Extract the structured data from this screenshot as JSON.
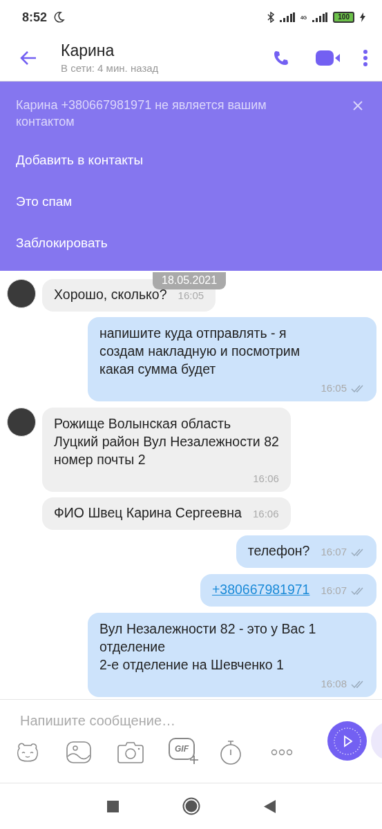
{
  "status_bar": {
    "time": "8:52",
    "battery": "100",
    "network": "4G"
  },
  "header": {
    "title": "Карина",
    "subtitle": "В сети: 4 мин. назад"
  },
  "banner": {
    "message": "Карина +380667981971 не является вашим контактом",
    "actions": [
      "Добавить в контакты",
      "Это спам",
      "Заблокировать"
    ]
  },
  "date_label": "18.05.2021",
  "messages": [
    {
      "outgoing": false,
      "kind": "text",
      "avatar": true,
      "text": "Хорошо, сколько?",
      "time": "16:05"
    },
    {
      "outgoing": true,
      "kind": "text",
      "text": "напишите куда отправлять - я\nсоздам накладную и посмотрим\nкакая сумма будет",
      "time": "16:05",
      "read": true
    },
    {
      "outgoing": false,
      "kind": "text",
      "avatar": true,
      "text": "Рожище Волынская область\nЛуцкий район Вул Незалежности 82\nномер почты 2",
      "time": "16:06"
    },
    {
      "outgoing": false,
      "kind": "text",
      "avatar": false,
      "text": "ФИО Швец Карина Сергеевна",
      "time": "16:06"
    },
    {
      "outgoing": true,
      "kind": "text",
      "text": "телефон?",
      "time": "16:07",
      "read": true
    },
    {
      "outgoing": true,
      "kind": "link",
      "text": "+380667981971",
      "time": "16:07",
      "read": true
    },
    {
      "outgoing": true,
      "kind": "text",
      "text": "Вул Незалежности 82  - это у Вас 1\nотделение\n2-е отделение на Шевченко 1",
      "time": "16:08",
      "read": true
    }
  ],
  "composer": {
    "placeholder": "Напишите сообщение…",
    "gif_label": "GIF"
  }
}
